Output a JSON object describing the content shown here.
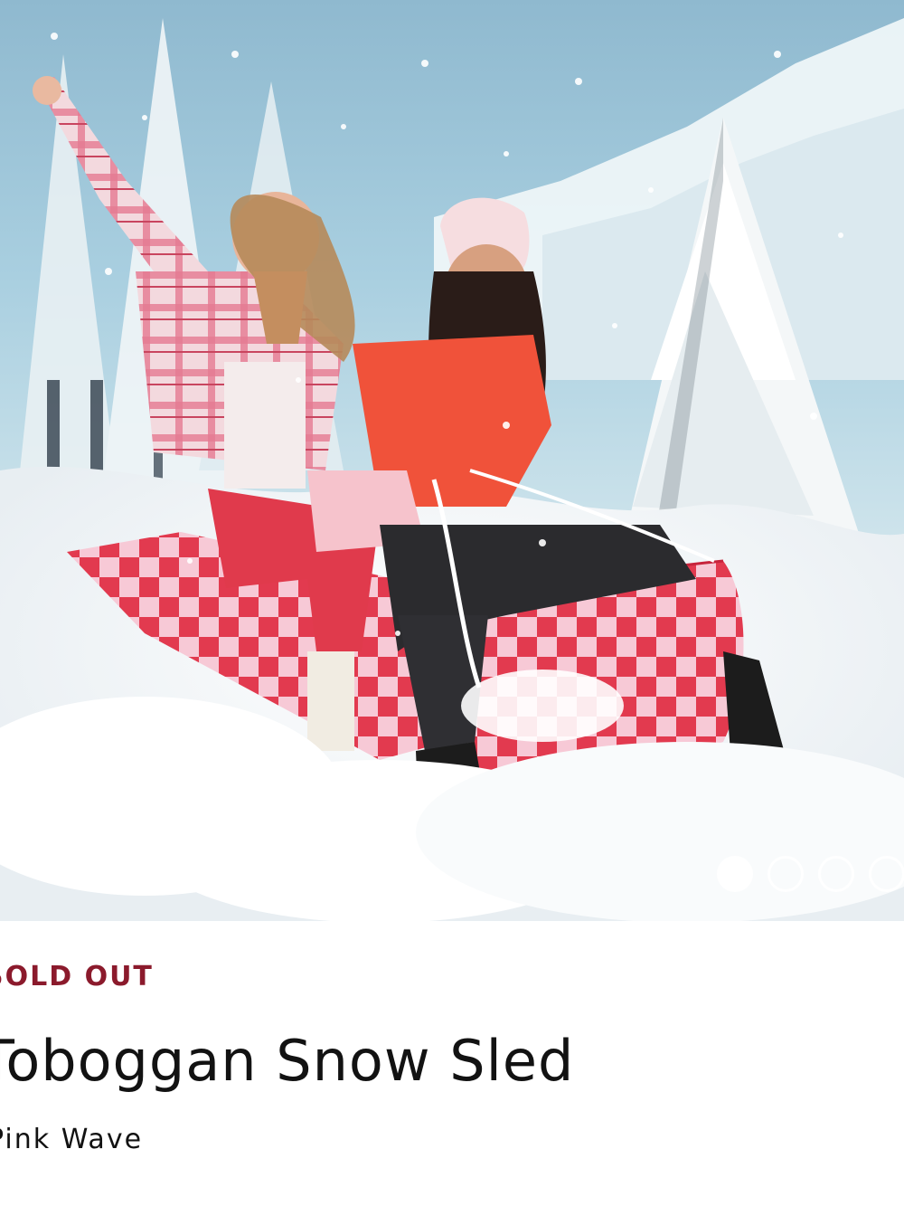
{
  "gallery": {
    "image_alt": "Two women riding a pink and red checkered inflatable toboggan sled in the snow",
    "slide_count": 4,
    "active_slide": 1
  },
  "product": {
    "status": "SOLD OUT",
    "name": "Toboggan Snow Sled",
    "variant": "Pink Wave"
  },
  "colors": {
    "status": "#8b1a2c",
    "text": "#121212",
    "sled_red": "#e23a4f",
    "sled_pink": "#f7c9d6"
  }
}
